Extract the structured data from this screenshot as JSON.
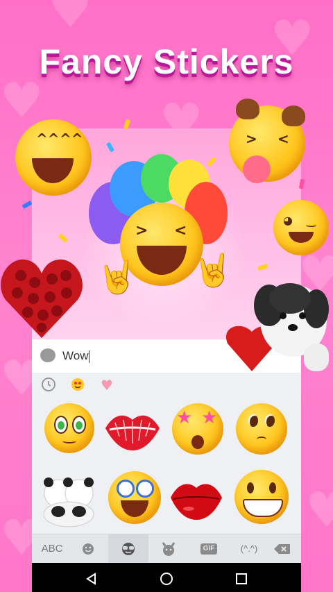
{
  "promo": {
    "title": "Fancy Stickers"
  },
  "input": {
    "value": "Wow"
  },
  "categories": [
    "recent-icon",
    "emoji-sticker-icon",
    "heart-sticker-icon"
  ],
  "toolbar": {
    "abc_label": "ABC",
    "gif_label": "GIF",
    "kaomoji_label": "(^.^)"
  },
  "stickers": [
    "blushing-wide-eye-emoji",
    "lips-kiss-sticker",
    "star-eyes-shocked-emoji",
    "teary-hopeful-emoji",
    "panda-hug-sticker",
    "nerd-laughing-emoji",
    "red-lips-sticker",
    "big-grin-emoji"
  ],
  "colors": {
    "background": "#ff76c9",
    "keyboard": "#eef0f3",
    "navbar": "#000000",
    "title_shadow": "#b5179e"
  }
}
